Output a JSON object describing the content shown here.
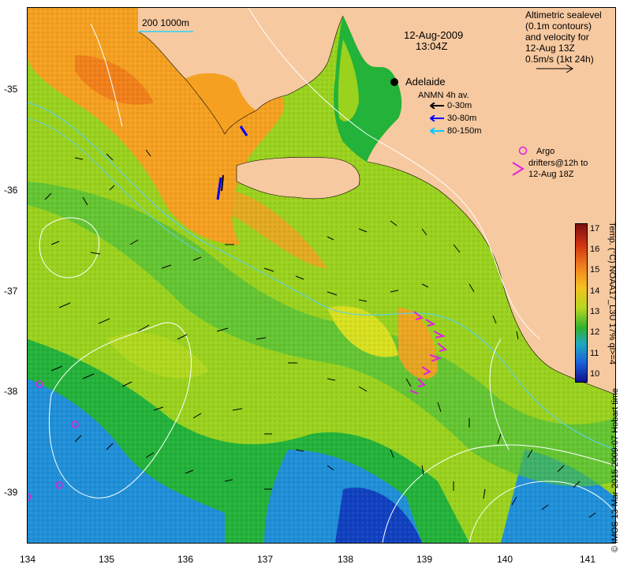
{
  "title": {
    "date": "12-Aug-2009",
    "time": "13:04Z"
  },
  "scale_bar": {
    "label": "200  1000m"
  },
  "altimetry_note": {
    "line1": "Altimetric sealevel",
    "line2": "(0.1m contours)",
    "line3": "and velocity for",
    "line4": "12-Aug 13Z",
    "line5": "0.5m/s (1kt 24h)"
  },
  "city": {
    "name": "Adelaide"
  },
  "anmn_legend": {
    "title": "ANMN 4h av.",
    "items": [
      {
        "label": "0-30m",
        "color": "#000000"
      },
      {
        "label": "30-80m",
        "color": "#0000ff"
      },
      {
        "label": "80-150m",
        "color": "#00ccff"
      }
    ]
  },
  "argo_legend": {
    "argo_label": "Argo",
    "drifters_line1": "drifters@12h to",
    "drifters_line2": "12-Aug 18Z",
    "marker_color": "#e020e0"
  },
  "colorbar": {
    "title": "Temp. (°C) NOAA17_L3U 17% ql>=4",
    "ticks": [
      "17",
      "16",
      "15",
      "14",
      "13",
      "12",
      "11",
      "10"
    ],
    "min": 10,
    "max": 17.5
  },
  "credit": "© IMOS 13-Mar-2015 2009:07 Hobart time",
  "axes": {
    "x_ticks": [
      "134",
      "135",
      "136",
      "137",
      "138",
      "139",
      "140",
      "141"
    ],
    "y_ticks": [
      "-35",
      "-36",
      "-37",
      "-38",
      "-39"
    ]
  },
  "colors": {
    "land": "#f7c9a0",
    "sst_warm": "#f5a020",
    "sst_mid": "#9ad21e",
    "sst_green": "#23b23a",
    "sst_cool": "#1f8fd8",
    "sst_cold": "#1040c0",
    "contour": "#ffffff",
    "isobath": "#5fd0e0"
  }
}
